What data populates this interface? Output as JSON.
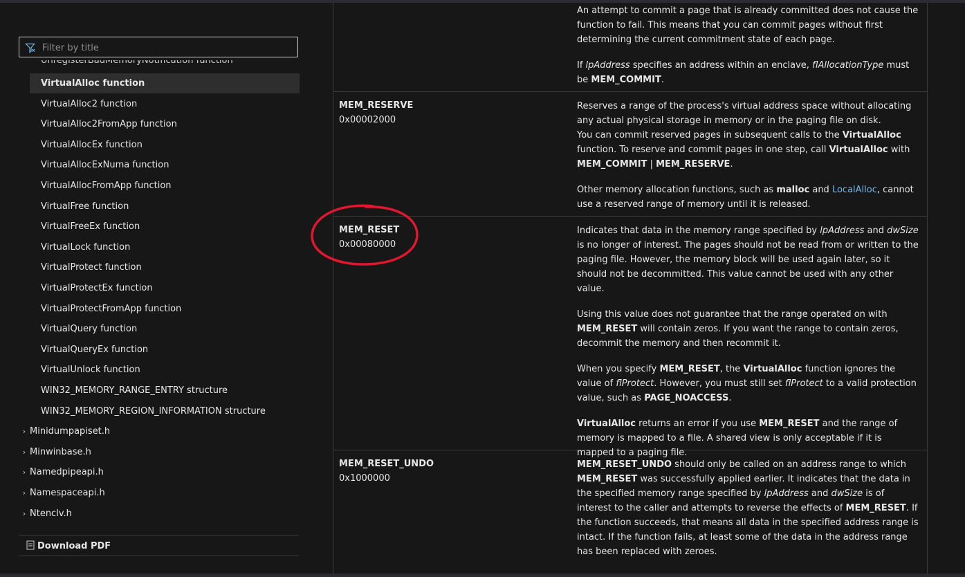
{
  "sidebar": {
    "filter_placeholder": "Filter by title",
    "clipped_item": "UnregisterBadMemoryNotification function",
    "items": [
      {
        "label": "VirtualAlloc function",
        "selected": true
      },
      {
        "label": "VirtualAlloc2 function"
      },
      {
        "label": "VirtualAlloc2FromApp function"
      },
      {
        "label": "VirtualAllocEx function"
      },
      {
        "label": "VirtualAllocExNuma function"
      },
      {
        "label": "VirtualAllocFromApp function"
      },
      {
        "label": "VirtualFree function"
      },
      {
        "label": "VirtualFreeEx function"
      },
      {
        "label": "VirtualLock function"
      },
      {
        "label": "VirtualProtect function"
      },
      {
        "label": "VirtualProtectEx function"
      },
      {
        "label": "VirtualProtectFromApp function"
      },
      {
        "label": "VirtualQuery function"
      },
      {
        "label": "VirtualQueryEx function"
      },
      {
        "label": "VirtualUnlock function"
      },
      {
        "label": "WIN32_MEMORY_RANGE_ENTRY structure"
      },
      {
        "label": "WIN32_MEMORY_REGION_INFORMATION structure"
      }
    ],
    "groups": [
      {
        "label": "Minidumpapiset.h"
      },
      {
        "label": "Minwinbase.h"
      },
      {
        "label": "Namedpipeapi.h"
      },
      {
        "label": "Namespaceapi.h"
      },
      {
        "label": "Ntenclv.h"
      }
    ],
    "download_pdf": "Download PDF"
  },
  "table": {
    "rows": [
      {
        "name": "",
        "value": "",
        "paragraphs": [
          "An attempt to commit a page that is already committed does not cause the function to fail. This means that you can commit pages without first determining the current commitment state of each page.",
          "If lpAddress specifies an address within an enclave, flAllocationType must be MEM_COMMIT."
        ]
      },
      {
        "name": "MEM_RESERVE",
        "value": "0x00002000",
        "paragraphs": [
          "Reserves a range of the process's virtual address space without allocating any actual physical storage in memory or in the paging file on disk. You can commit reserved pages in subsequent calls to the VirtualAlloc function. To reserve and commit pages in one step, call VirtualAlloc with MEM_COMMIT | MEM_RESERVE.",
          "Other memory allocation functions, such as malloc and LocalAlloc, cannot use a reserved range of memory until it is released."
        ]
      },
      {
        "name": "MEM_RESET",
        "value": "0x00080000",
        "paragraphs": [
          "Indicates that data in the memory range specified by lpAddress and dwSize is no longer of interest. The pages should not be read from or written to the paging file. However, the memory block will be used again later, so it should not be decommitted. This value cannot be used with any other value.",
          "Using this value does not guarantee that the range operated on with MEM_RESET will contain zeros. If you want the range to contain zeros, decommit the memory and then recommit it.",
          "When you specify MEM_RESET, the VirtualAlloc function ignores the value of flProtect. However, you must still set flProtect to a valid protection value, such as PAGE_NOACCESS.",
          "VirtualAlloc returns an error if you use MEM_RESET and the range of memory is mapped to a file. A shared view is only acceptable if it is mapped to a paging file."
        ]
      },
      {
        "name": "MEM_RESET_UNDO",
        "value": "0x1000000",
        "paragraphs": [
          "MEM_RESET_UNDO should only be called on an address range to which MEM_RESET was successfully applied earlier. It indicates that the data in the specified memory range specified by lpAddress and dwSize is of interest to the caller and attempts to reverse the effects of MEM_RESET. If the function succeeds, that means all data in the specified address range is intact. If the function fails, at least some of the data in the address range has been replaced with zeroes."
        ]
      }
    ]
  },
  "colors": {
    "background": "#171717",
    "text": "#e6e6e6",
    "link": "#75b6e7",
    "selected_bg": "#2e2e2e",
    "annotation": "#e0182f"
  },
  "icons": {
    "filter": "filter-icon",
    "chevron": "chevron-right-icon",
    "pdf": "pdf-icon"
  }
}
